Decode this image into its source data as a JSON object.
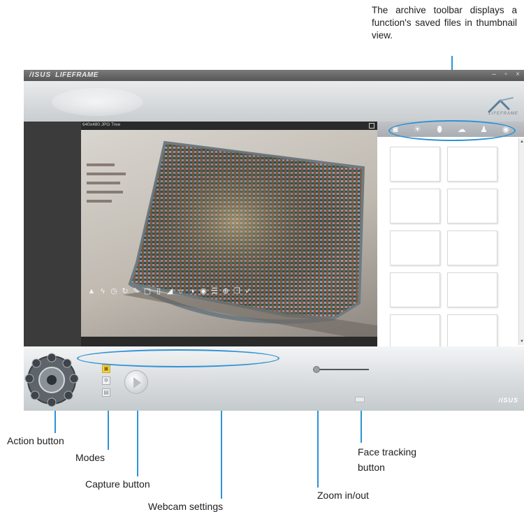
{
  "callouts": {
    "archive_toolbar": "The archive toolbar displays a function's saved files in thumbnail view.",
    "action_button": "Action button",
    "modes": "Modes",
    "capture_button": "Capture button",
    "webcam_settings": "Webcam settings",
    "zoom": "Zoom in/out",
    "face_tracking": "Face tracking button"
  },
  "app": {
    "brand": "/ISUS",
    "product": "LIFEFRAME",
    "logo_text": "LIFEFRAME",
    "preview_label": "640x480  JPG  Tree",
    "footer_logo": "/ISUS"
  },
  "archive": {
    "thumbnail_count": 10
  },
  "colors": {
    "callout_accent": "#2c93d6",
    "active_mode": "#f4d24a"
  }
}
